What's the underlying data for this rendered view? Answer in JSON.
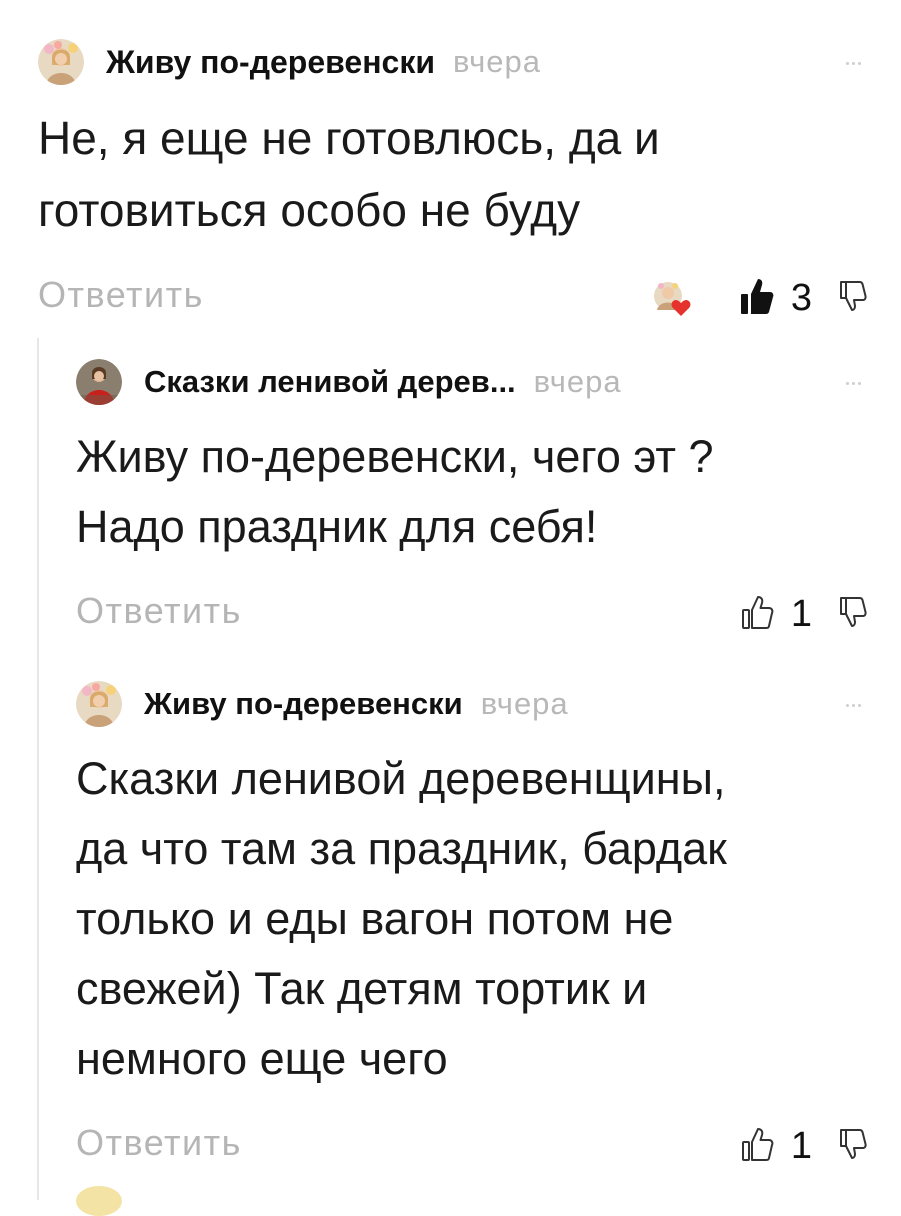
{
  "comments": [
    {
      "author": "Живу по-деревенски",
      "time": "вчера",
      "text_lines": [
        "Не, я еще не готовлюсь, да и",
        "готовиться особо не буду"
      ],
      "reply_label": "Ответить",
      "likes": "3",
      "liked": true,
      "author_liked": true
    },
    {
      "author": "Сказки ленивой дерев...",
      "time": "вчера",
      "text_lines": [
        "Живу по-деревенски, чего эт ?",
        "Надо праздник для себя!"
      ],
      "reply_label": "Ответить",
      "likes": "1",
      "liked": false
    },
    {
      "author": "Живу по-деревенски",
      "time": "вчера",
      "text_lines": [
        "Сказки ленивой деревенщины,",
        "да что там за праздник, бардак",
        "только и еды вагон потом не",
        "свежей) Так детям тортик и",
        "немного еще чего"
      ],
      "reply_label": "Ответить",
      "likes": "1",
      "liked": false
    }
  ],
  "colors": {
    "text": "#1a1a1a",
    "muted": "#b5b5b5",
    "heart": "#e5322d",
    "thread_line": "#e6e6e6"
  },
  "icons": {
    "like": "thumbs-up-icon",
    "dislike": "thumbs-down-icon",
    "more": "more-dots-icon",
    "author_like": "author-heart-avatar-icon"
  }
}
